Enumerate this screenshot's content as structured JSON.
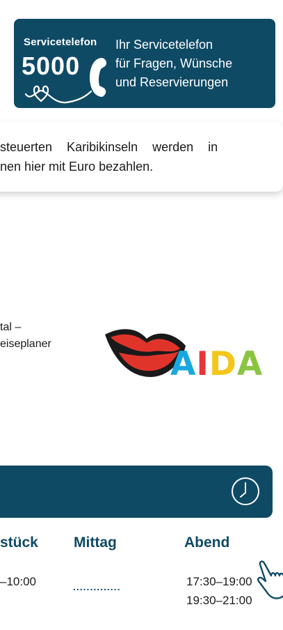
{
  "service": {
    "logo_small": "Servicetelefon",
    "logo_number": "5000",
    "line1": "Ihr Servicetelefon",
    "line2": "für Fragen, Wünsche",
    "line3": "und Reservierungen",
    "icons": [
      "phone-icon",
      "heart-icon"
    ]
  },
  "info": {
    "line1": "esteuerten Karibikinseln werden in",
    "line2": "nnen hier mit Euro bezahlen."
  },
  "portal": {
    "line1": "tal –",
    "line2": "eiseplaner"
  },
  "brand": {
    "letters": [
      "A",
      "I",
      "D",
      "A"
    ],
    "letter_colors": [
      "#19a7e0",
      "#e8353a",
      "#f4c619",
      "#8ac541"
    ]
  },
  "times": {
    "columns": [
      "stück",
      "Mittag",
      "Abend"
    ],
    "breakfast": "–10:00",
    "lunch_placeholder": "..............",
    "dinner": [
      "17:30–19:00",
      "19:30–21:00"
    ]
  },
  "colors": {
    "primary": "#0f4a65",
    "lips_red": "#e0342b"
  }
}
